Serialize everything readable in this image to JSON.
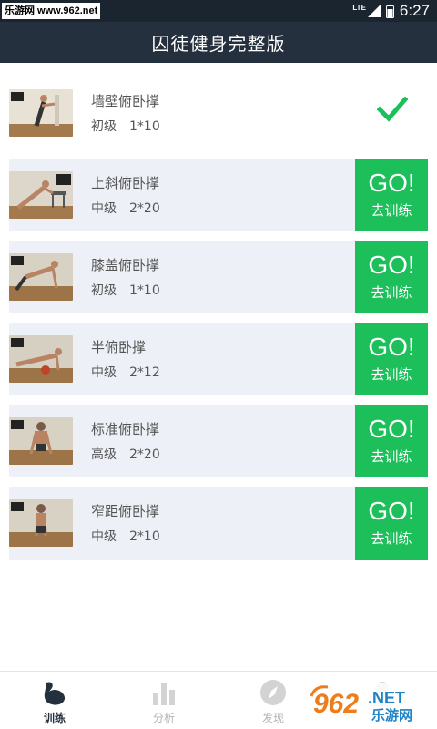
{
  "status_bar": {
    "watermark": "乐游网 www.962.net",
    "network": "LTE",
    "time": "6:27"
  },
  "header": {
    "title": "囚徒健身完整版"
  },
  "exercises": [
    {
      "name": "墙壁俯卧撑",
      "level": "初级",
      "reps": "1*10",
      "state": "completed"
    },
    {
      "name": "上斜俯卧撑",
      "level": "中级",
      "reps": "2*20",
      "go_label": "GO!",
      "train_label": "去训练"
    },
    {
      "name": "膝盖俯卧撑",
      "level": "初级",
      "reps": "1*10",
      "go_label": "GO!",
      "train_label": "去训练"
    },
    {
      "name": "半俯卧撑",
      "level": "中级",
      "reps": "2*12",
      "go_label": "GO!",
      "train_label": "去训练"
    },
    {
      "name": "标准俯卧撑",
      "level": "高级",
      "reps": "2*20",
      "go_label": "GO!",
      "train_label": "去训练"
    },
    {
      "name": "窄距俯卧撑",
      "level": "中级",
      "reps": "2*10",
      "go_label": "GO!",
      "train_label": "去训练"
    }
  ],
  "tabs": [
    {
      "label": "训练",
      "icon": "flexed-arm-icon",
      "active": true
    },
    {
      "label": "分析",
      "icon": "bar-chart-icon"
    },
    {
      "label": "发现",
      "icon": "compass-icon"
    },
    {
      "label": "",
      "icon": "profile-icon"
    }
  ],
  "watermark_br": {
    "text": "962",
    "suffix": ".NET",
    "subtitle": "乐游网"
  },
  "colors": {
    "status_bar": "#1b2530",
    "header": "#24303d",
    "row_bg": "#edf1f7",
    "go_green": "#1cbf5a",
    "check_green": "#1cbf5a",
    "tab_inactive": "#b5b5b5"
  }
}
